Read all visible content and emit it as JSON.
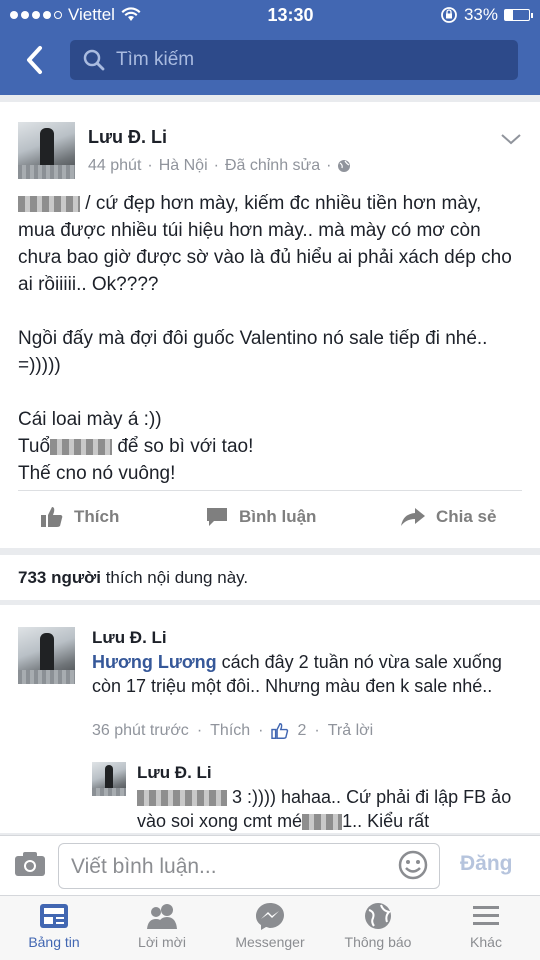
{
  "status_bar": {
    "carrier": "Viettel",
    "time": "13:30",
    "battery": "33%",
    "battery_level": 0.33,
    "signal_bars": 4
  },
  "nav": {
    "search_placeholder": "Tìm kiếm"
  },
  "post": {
    "author": "Lưu Đ. Li",
    "time": "44 phút",
    "location": "Hà Nội",
    "edited": "Đã chỉnh sửa",
    "paragraph1": "/ cứ đẹp hơn mày, kiếm đc nhiều tiền hơn mày, mua được nhiều túi hiệu hơn mày.. mà mày có mơ còn chưa bao giờ được sờ vào là đủ hiểu ai phải xách dép cho ai rồiiiii.. Ok????",
    "paragraph2": "Ngồi đấy mà đợi đôi guốc Valentino nó sale tiếp đi nhé.. =)))))",
    "line3": "Cái loai mày á :))",
    "line4_a": "Tuổ",
    "line4_b": " để so bì với tao!",
    "line5": "Thế cno nó vuông!",
    "actions": {
      "like": "Thích",
      "comment": "Bình luận",
      "share": "Chia sẻ"
    }
  },
  "likes_summary": {
    "count": "733 người",
    "text": " thích nội dung này."
  },
  "comment": {
    "author": "Lưu Đ. Li",
    "tag": "Hương Lương",
    "text": " cách đây 2 tuần nó vừa sale xuống còn 17 triệu một đôi.. Nhưng màu đen k sale nhé..",
    "time": "36 phút trước",
    "like": "Thích",
    "like_count": "2",
    "reply": "Trả lời"
  },
  "reply": {
    "author": "Lưu Đ. Li",
    "text_a": "3 :)))) hahaa.. Cứ phải đi lập FB ảo vào soi xong cmt mé",
    "text_b": "1.. Kiểu rất"
  },
  "composer": {
    "placeholder": "Viết bình luận...",
    "send": "Đăng"
  },
  "tabs": [
    {
      "label": "Bảng tin",
      "icon": "news-feed-icon",
      "active": true
    },
    {
      "label": "Lời mời",
      "icon": "friend-requests-icon",
      "active": false
    },
    {
      "label": "Messenger",
      "icon": "messenger-icon",
      "active": false
    },
    {
      "label": "Thông báo",
      "icon": "globe-icon",
      "active": false
    },
    {
      "label": "Khác",
      "icon": "menu-icon",
      "active": false
    }
  ],
  "colors": {
    "brand": "#4267b2",
    "link": "#365899",
    "meta": "#90949c"
  }
}
